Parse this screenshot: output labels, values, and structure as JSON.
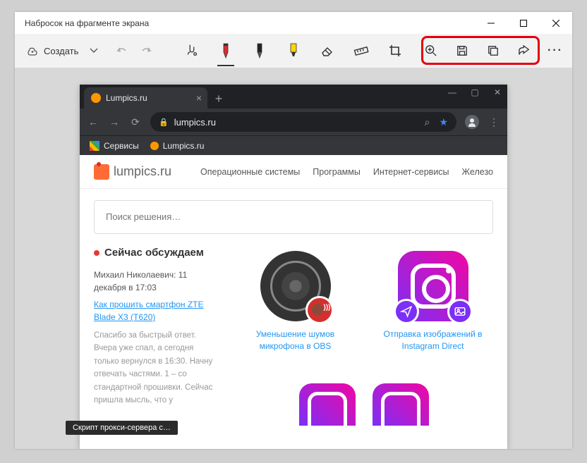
{
  "window": {
    "title": "Набросок на фрагменте экрана"
  },
  "toolbar": {
    "create_label": "Создать",
    "right_icons": [
      "zoom",
      "save",
      "copy",
      "share"
    ]
  },
  "browser": {
    "tab_title": "Lumpics.ru",
    "url_display": "lumpics.ru",
    "bookmarks": {
      "services": "Сервисы",
      "site": "Lumpics.ru"
    }
  },
  "page": {
    "logo_text": "lumpics.ru",
    "nav": [
      "Операционные системы",
      "Программы",
      "Интернет-сервисы",
      "Железо"
    ],
    "search_placeholder": "Поиск решения…",
    "discuss_heading": "Сейчас обсуждаем",
    "author_line": "Михаил Николаевич: 11 декабря в 17:03",
    "link_text": "Как прошить смартфон ZTE Blade X3 (T620)",
    "comment_text": "Спасибо за быстрый ответ. Вчера уже спал, а сегодня только вернулся в 16:30. Начну отвечать частями. 1 – со стандартной прошивки. Сейчас пришла мысль, что у",
    "articles": [
      {
        "title": "Уменьшение шумов микрофона в OBS"
      },
      {
        "title": "Отправка изображений в Instagram Direct"
      }
    ]
  },
  "tooltip": "Скрипт прокси-сервера с…"
}
